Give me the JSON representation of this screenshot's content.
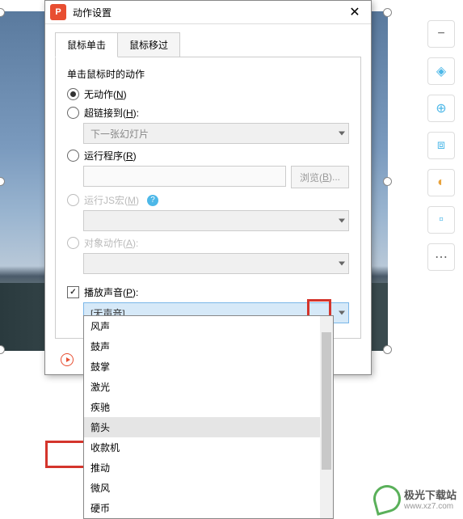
{
  "dialog": {
    "title": "动作设置",
    "tabs": {
      "mouse_click": "鼠标单击",
      "mouse_over": "鼠标移过"
    },
    "group_label": "单击鼠标时的动作",
    "radios": {
      "none": "无动作(N)",
      "hyperlink": "超链接到(H):",
      "hyperlink_value": "下一张幻灯片",
      "run_program": "运行程序(R)",
      "browse_btn": "浏览(B)...",
      "run_js": "运行JS宏(M)",
      "object_action": "对象动作(A):"
    },
    "sound": {
      "label": "播放声音(P):",
      "selected": "[无声音]",
      "options": [
        "风声",
        "鼓声",
        "鼓掌",
        "激光",
        "疾驰",
        "箭头",
        "收款机",
        "推动",
        "微风",
        "硬币"
      ]
    }
  },
  "sidebar": {
    "minus": "−",
    "layers": "◈",
    "zoom": "⊕",
    "crop": "⧈",
    "bulb": "◐",
    "doc": "▫",
    "more": "⋯"
  },
  "watermark": {
    "text": "极光下载站",
    "url": "www.xz7.com"
  }
}
